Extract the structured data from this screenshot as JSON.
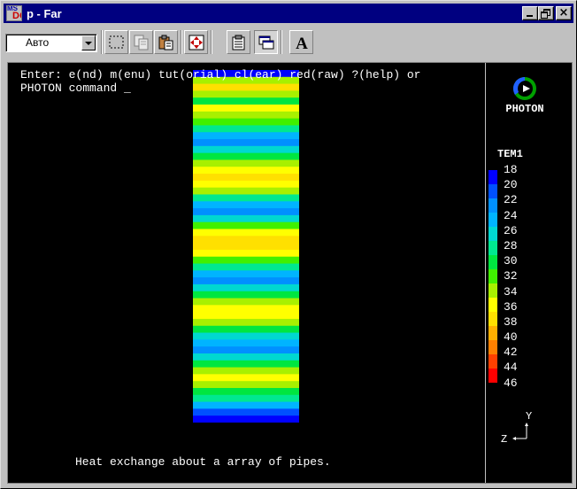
{
  "window": {
    "title": "p - Far",
    "app_icon_top": "MS",
    "app_icon_bottom": "DOS",
    "minimize_icon": "minimize-icon",
    "restore_icon": "restore-icon",
    "close_icon": "close-icon",
    "close_glyph": "×"
  },
  "toolbar": {
    "font_size_value": "Авто",
    "tools": [
      "mark-icon",
      "copy-icon",
      "paste-icon",
      "fullscreen-icon",
      "properties-icon",
      "background-icon",
      "font-icon"
    ],
    "font_glyph": "A"
  },
  "console": {
    "prompt_line1": "Enter: e(nd) m(enu) tut(orial) cl(ear) red(raw) ?(help) or",
    "prompt_line2": "PHOTON command _",
    "caption": "Heat exchange about a array of pipes."
  },
  "photon": {
    "logo_text": "PHOTON",
    "legend_title": "TEM1",
    "legend_labels": [
      "18",
      "20",
      "22",
      "24",
      "26",
      "28",
      "30",
      "32",
      "34",
      "36",
      "38",
      "40",
      "42",
      "44",
      "46"
    ],
    "legend_colors": [
      "#0000ff",
      "#0050ff",
      "#0090ff",
      "#00b4ff",
      "#00d8d0",
      "#00e890",
      "#00e640",
      "#40f000",
      "#a8f000",
      "#ffff00",
      "#ffe000",
      "#ffb000",
      "#ff8000",
      "#ff4000",
      "#ff0000"
    ],
    "axis_y": "Y",
    "axis_z": "Z"
  },
  "chart_data": {
    "type": "heatmap",
    "variable": "TEM1",
    "scale_min": 18,
    "scale_max": 46,
    "rows_top_to_bottom": [
      18,
      34,
      37,
      34,
      30,
      36,
      34,
      32,
      28,
      24,
      22,
      26,
      30,
      34,
      36,
      37,
      36,
      33,
      28,
      24,
      22,
      26,
      31,
      35,
      37,
      37,
      35,
      32,
      28,
      24,
      22,
      26,
      30,
      34,
      36,
      36,
      34,
      30,
      26,
      23,
      22,
      26,
      30,
      34,
      36,
      34,
      30,
      27,
      24,
      20,
      18
    ]
  }
}
